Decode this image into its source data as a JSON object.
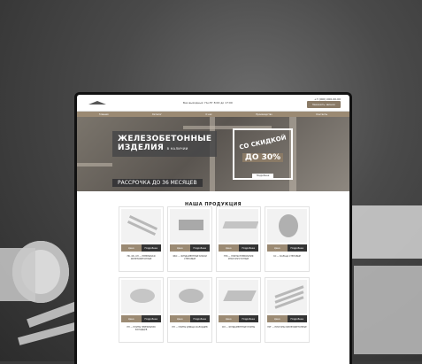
{
  "header": {
    "logo_text": "",
    "phone_label": "Без выходных: Пн-Пт 8:00 до 17:00",
    "phone": "+7 (000) 000-00-00",
    "call_button": "Заказать звонок"
  },
  "nav": {
    "items": [
      "Главная",
      "Каталог",
      "О нас",
      "Производство",
      "Контакты"
    ]
  },
  "hero": {
    "title_line1": "ЖЕЛЕЗОБЕТОННЫЕ",
    "title_line2": "ИЗДЕЛИЯ",
    "title_small": "В НАЛИЧИИ",
    "subtitle": "РАССРОЧКА ДО 36 МЕСЯЦЕВ",
    "promo_line1": "СО СКИДКОЙ",
    "promo_line2": "ДО 30%",
    "promo_button": "Подробнее"
  },
  "products": {
    "title": "НАША ПРОДУКЦИЯ",
    "price_button": "Цена",
    "details_button": "Подробнее",
    "items": [
      {
        "name": "ПБ, ОБ, ОП — ПЕРЕМЫЧКИ ЖЕЛЕЗОБЕТОННЫЕ"
      },
      {
        "name": "ФБС — ФУНДАМЕНТНЫЕ БЛОКИ СТЕНОВЫЕ"
      },
      {
        "name": "ПТК — ПЛИТЫ ПЕРЕКРЫТИЯ МНОГОПУСТОТНЫЕ"
      },
      {
        "name": "КС — КОЛЬЦА СТЕНОВЫЕ"
      },
      {
        "name": "ПП — ПЛИТЫ ПЕРЕКРЫТИЯ КОЛОДЦЕВ"
      },
      {
        "name": "ПН — ПЛИТЫ ДНИЩА КОЛОДЦЕВ"
      },
      {
        "name": "ФЛ — ФУНДАМЕНТНЫЕ ПЛИТЫ"
      },
      {
        "name": "ПРГ — ПРОГОНЫ ЖЕЛЕЗОБЕТОННЫЕ"
      }
    ]
  }
}
